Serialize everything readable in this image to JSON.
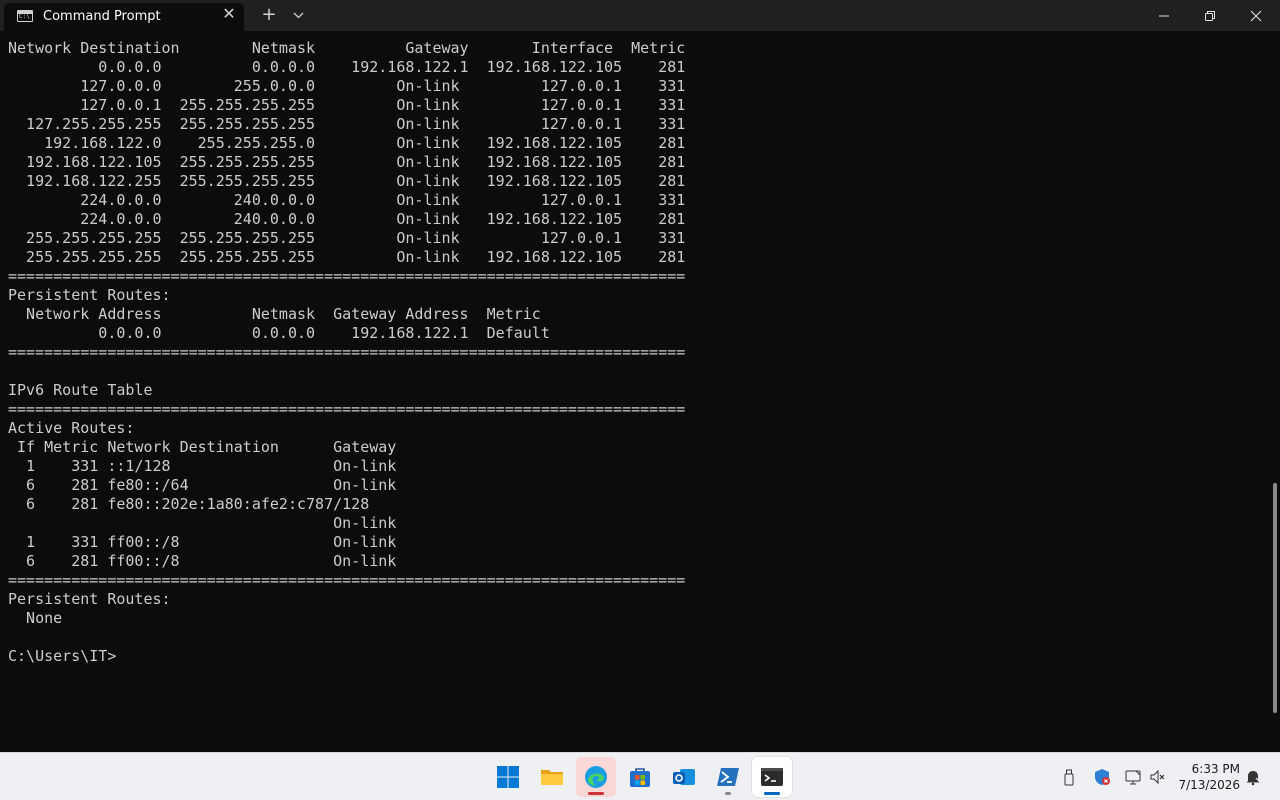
{
  "window": {
    "tab_title": "Command Prompt",
    "tab_icon": "cmd-icon",
    "new_tab_symbol": "+",
    "close_symbol": "✕"
  },
  "terminal": {
    "lines": [
      "Network Destination        Netmask          Gateway       Interface  Metric",
      "          0.0.0.0          0.0.0.0    192.168.122.1  192.168.122.105    281",
      "        127.0.0.0        255.0.0.0         On-link         127.0.0.1    331",
      "        127.0.0.1  255.255.255.255         On-link         127.0.0.1    331",
      "  127.255.255.255  255.255.255.255         On-link         127.0.0.1    331",
      "    192.168.122.0    255.255.255.0         On-link   192.168.122.105    281",
      "  192.168.122.105  255.255.255.255         On-link   192.168.122.105    281",
      "  192.168.122.255  255.255.255.255         On-link   192.168.122.105    281",
      "        224.0.0.0        240.0.0.0         On-link         127.0.0.1    331",
      "        224.0.0.0        240.0.0.0         On-link   192.168.122.105    281",
      "  255.255.255.255  255.255.255.255         On-link         127.0.0.1    331",
      "  255.255.255.255  255.255.255.255         On-link   192.168.122.105    281",
      "===========================================================================",
      "Persistent Routes:",
      "  Network Address          Netmask  Gateway Address  Metric",
      "          0.0.0.0          0.0.0.0    192.168.122.1  Default",
      "===========================================================================",
      "",
      "IPv6 Route Table",
      "===========================================================================",
      "Active Routes:",
      " If Metric Network Destination      Gateway",
      "  1    331 ::1/128                  On-link",
      "  6    281 fe80::/64                On-link",
      "  6    281 fe80::202e:1a80:afe2:c787/128",
      "                                    On-link",
      "  1    331 ff00::/8                 On-link",
      "  6    281 ff00::/8                 On-link",
      "===========================================================================",
      "Persistent Routes:",
      "  None",
      "",
      "C:\\Users\\IT>"
    ]
  },
  "taskbar": {
    "apps": [
      {
        "name": "start",
        "icon": "windows-logo-icon"
      },
      {
        "name": "file-explorer",
        "icon": "folder-icon"
      },
      {
        "name": "edge",
        "icon": "edge-icon"
      },
      {
        "name": "store",
        "icon": "store-icon"
      },
      {
        "name": "outlook",
        "icon": "outlook-icon"
      },
      {
        "name": "powershell",
        "icon": "powershell-icon"
      },
      {
        "name": "terminal",
        "icon": "terminal-icon"
      }
    ],
    "tray_icons": [
      "usb-icon",
      "security-icon",
      "network-icon",
      "volume-muted-icon",
      "notification-icon"
    ],
    "clock": {
      "time": "6:33 PM",
      "date": "7/13/2026"
    }
  },
  "colors": {
    "terminal_bg": "#0c0c0c",
    "terminal_fg": "#cccccc",
    "titlebar_bg": "#202020",
    "taskbar_bg": "#eef0f4",
    "accent": "#0067c0"
  }
}
